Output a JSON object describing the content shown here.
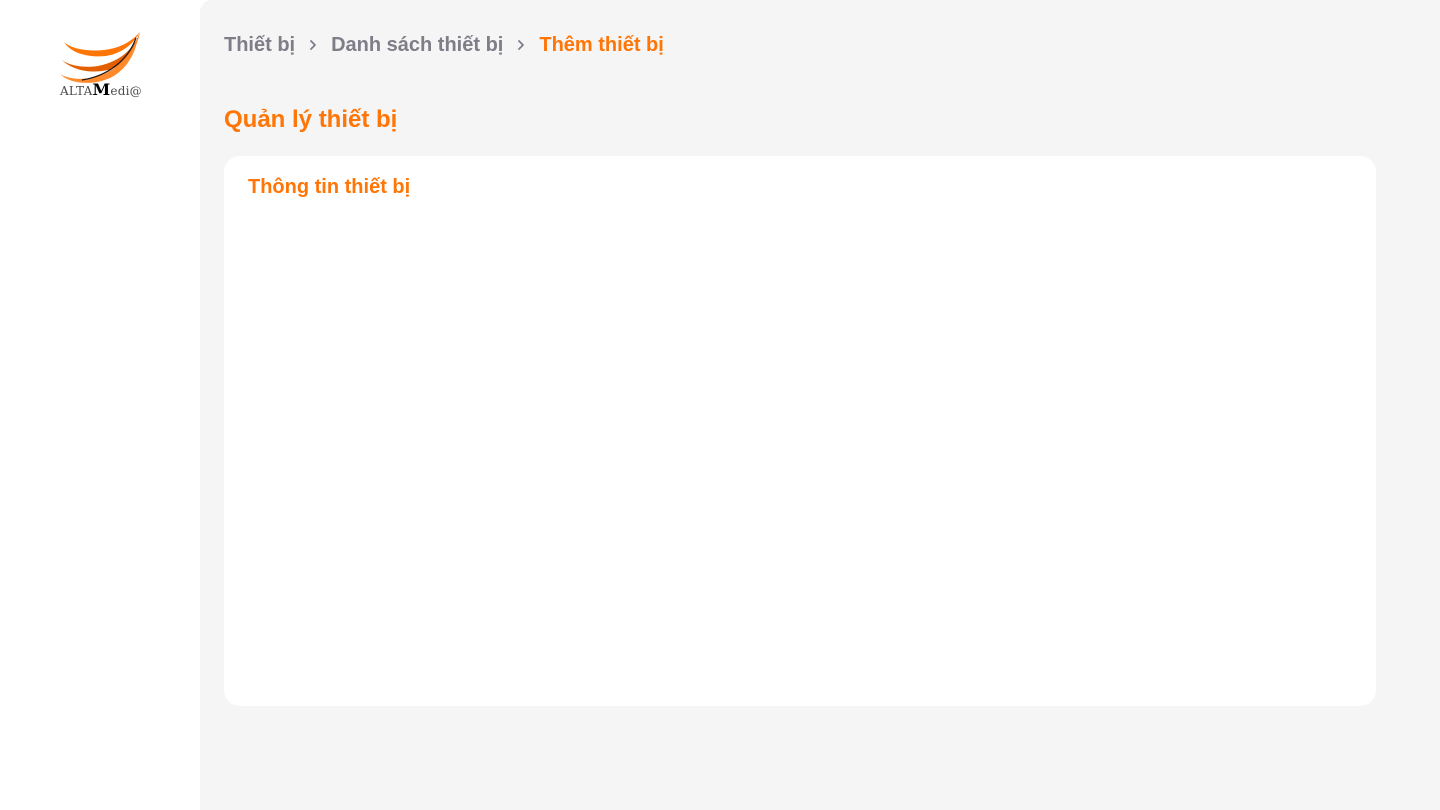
{
  "logo": {
    "text_small": "ALTA",
    "text_big": "M",
    "text_rest": "edi@"
  },
  "breadcrumb": {
    "items": [
      "Thiết bị",
      "Danh sách thiết bị",
      "Thêm thiết bị"
    ],
    "separator_icon": "chevron-right-icon"
  },
  "page": {
    "title": "Quản lý thiết bị"
  },
  "card": {
    "title": "Thông tin thiết bị"
  },
  "colors": {
    "accent": "#ff7506",
    "muted": "#7e7d88",
    "background": "#f5f5f5"
  }
}
